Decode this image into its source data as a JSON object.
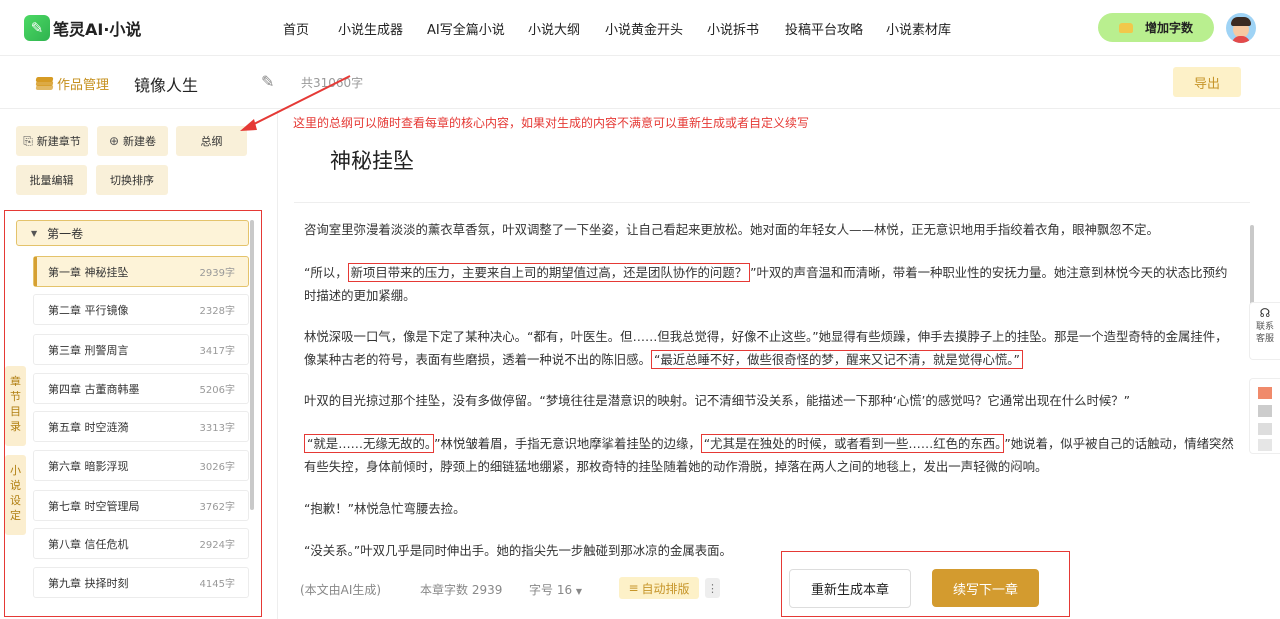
{
  "header": {
    "logo_text": "笔灵AI·小说",
    "nav": [
      "首页",
      "小说生成器",
      "AI写全篇小说",
      "小说大纲",
      "小说黄金开头",
      "小说拆书",
      "投稿平台攻略",
      "小说素材库"
    ],
    "add_words_label": "增加字数"
  },
  "subbar": {
    "works_label": "作品管理",
    "book_title": "镜像人生",
    "word_total": "共31060字",
    "export_label": "导出"
  },
  "sidebar": {
    "new_chapter": "新建章节",
    "new_volume": "新建卷",
    "outline": "总纲",
    "batch_edit": "批量编辑",
    "switch_sort": "切换排序",
    "volume_label": "第一卷",
    "chapters": [
      {
        "title": "第一章 神秘挂坠",
        "words": "2939字"
      },
      {
        "title": "第二章 平行镜像",
        "words": "2328字"
      },
      {
        "title": "第三章 刑警周言",
        "words": "3417字"
      },
      {
        "title": "第四章 古董商韩墨",
        "words": "5206字"
      },
      {
        "title": "第五章 时空涟漪",
        "words": "3313字"
      },
      {
        "title": "第六章 暗影浮现",
        "words": "3026字"
      },
      {
        "title": "第七章 时空管理局",
        "words": "3762字"
      },
      {
        "title": "第八章 信任危机",
        "words": "2924字"
      },
      {
        "title": "第九章 抉择时刻",
        "words": "4145字"
      }
    ],
    "tab_directory": "章节目录",
    "tab_settings": "小说设定"
  },
  "annotation": "这里的总纲可以随时查看每章的核心内容，如果对生成的内容不满意可以重新生成或者自定义续写",
  "editor": {
    "chapter_title": "神秘挂坠",
    "p1": "咨询室里弥漫着淡淡的薰衣草香氛，叶双调整了一下坐姿，让自己看起来更放松。她对面的年轻女人——林悦，正无意识地用手指绞着衣角，眼神飘忽不定。",
    "p2_a": "“所以，",
    "p2_hl": "新项目带来的压力，主要来自上司的期望值过高，还是团队协作的问题？",
    "p2_b": "”叶双的声音温和而清晰，带着一种职业性的安抚力量。她注意到林悦今天的状态比预约时描述的更加紧绷。",
    "p3_a": "林悦深吸一口气，像是下定了某种决心。“都有，叶医生。但……但我总觉得，好像不止这些。”她显得有些烦躁，伸手去摸脖子上的挂坠。那是一个造型奇特的金属挂件，像某种古老的符号，表面有些磨损，透着一种说不出的陈旧感。",
    "p3_hl": "“最近总睡不好，做些很奇怪的梦，醒来又记不清，就是觉得心慌。”",
    "p4": "叶双的目光掠过那个挂坠，没有多做停留。“梦境往往是潜意识的映射。记不清细节没关系，能描述一下那种‘心慌’的感觉吗？它通常出现在什么时候？”",
    "p5_hl1": "“就是……无缘无故的。",
    "p5_a": "”林悦皱着眉，手指无意识地摩挲着挂坠的边缘，",
    "p5_hl2": "“尤其是在独处的时候，或者看到一些……红色的东西。",
    "p5_b": "”她说着，似乎被自己的话触动，情绪突然有些失控，身体前倾时，脖颈上的细链猛地绷紧，那枚奇特的挂坠随着她的动作滑脱，掉落在两人之间的地毯上，发出一声轻微的闷响。",
    "p6": "“抱歉！”林悦急忙弯腰去捡。",
    "p7": "“没关系。”叶双几乎是同时伸出手。她的指尖先一步触碰到那冰凉的金属表面。"
  },
  "footer": {
    "ai_note": "(本文由AI生成)",
    "chapter_words": "本章字数 2939",
    "font_size": "字号 16",
    "auto_layout": "自动排版",
    "regen": "重新生成本章",
    "continue": "续写下一章"
  },
  "float": {
    "service_label": "联系客服"
  },
  "colors": {
    "accent": "#d39b2f",
    "annotation": "#e53935",
    "green": "#b9ef8f"
  }
}
